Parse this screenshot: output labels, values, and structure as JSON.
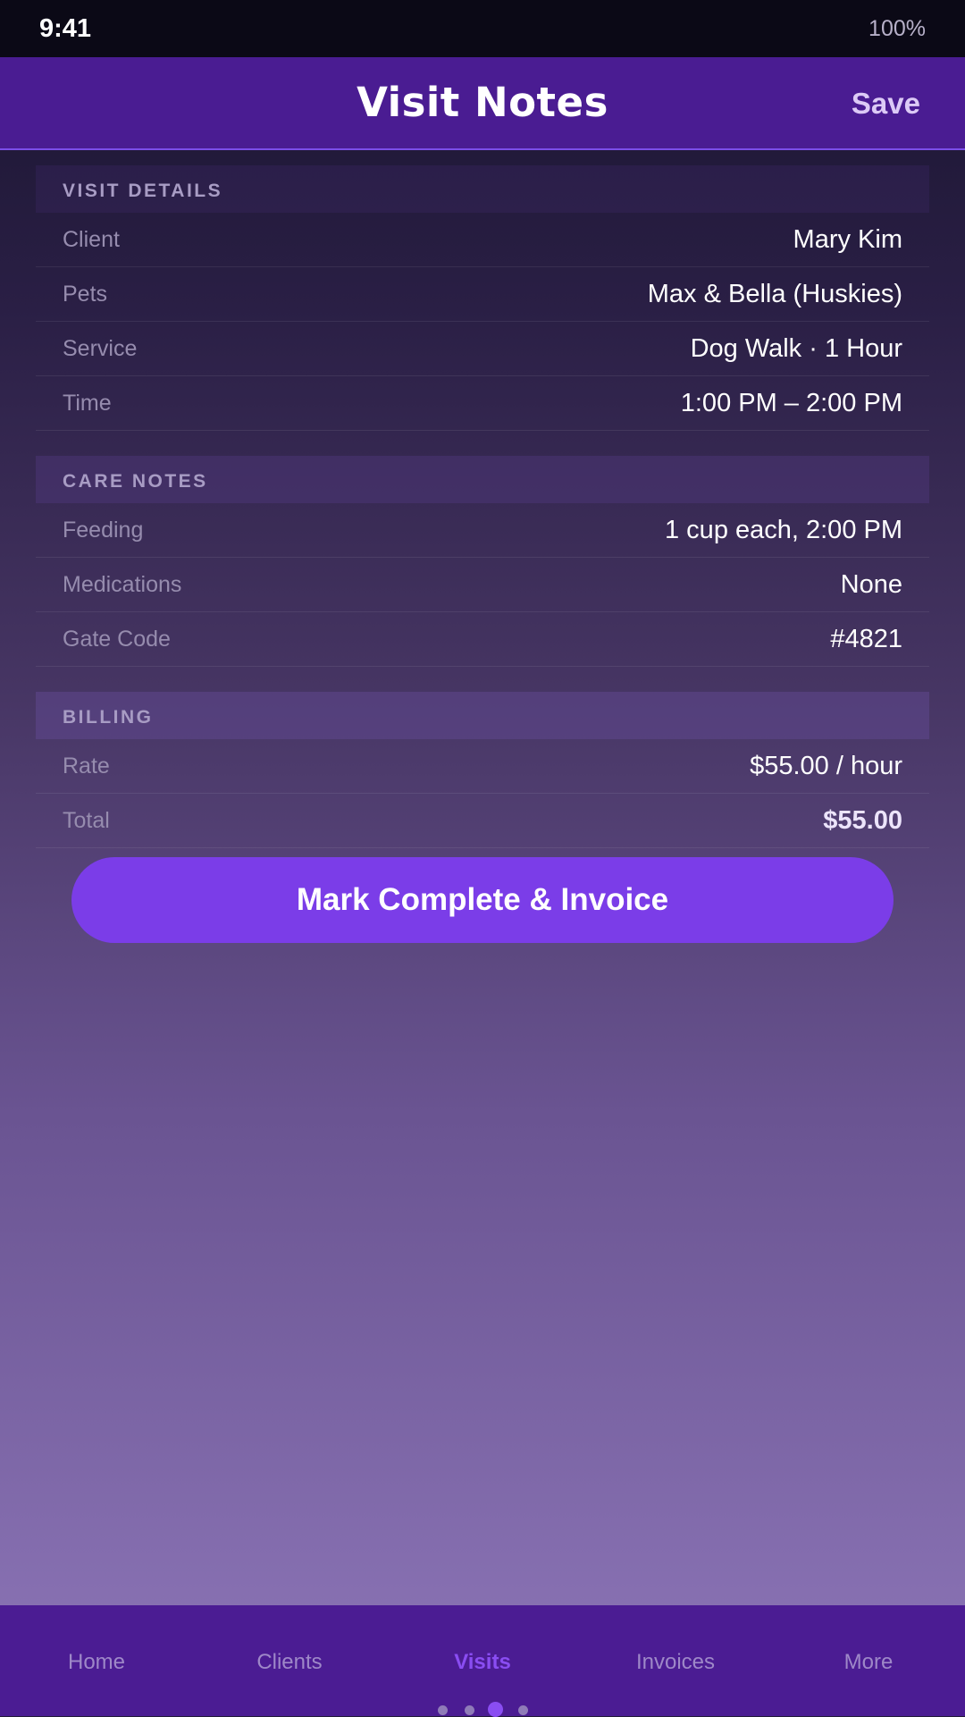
{
  "status_bar": {
    "time": "9:41",
    "battery": "100%"
  },
  "header": {
    "title": "Visit Notes",
    "save_label": "Save"
  },
  "sections": [
    {
      "title": "VISIT DETAILS",
      "rows": [
        {
          "label": "Client",
          "value": "Mary Kim"
        },
        {
          "label": "Pets",
          "value": "Max & Bella (Huskies)"
        },
        {
          "label": "Service",
          "value": "Dog Walk · 1 Hour"
        },
        {
          "label": "Time",
          "value": "1:00 PM – 2:00 PM"
        }
      ]
    },
    {
      "title": "CARE NOTES",
      "rows": [
        {
          "label": "Feeding",
          "value": "1 cup each, 2:00 PM"
        },
        {
          "label": "Medications",
          "value": "None"
        },
        {
          "label": "Gate Code",
          "value": "#4821"
        }
      ]
    },
    {
      "title": "BILLING",
      "rows": [
        {
          "label": "Rate",
          "value": "$55.00 / hour"
        },
        {
          "label": "Total",
          "value": "$55.00"
        }
      ]
    }
  ],
  "primary_action": {
    "label": "Mark Complete & Invoice"
  },
  "tab_bar": {
    "tabs": [
      {
        "label": "Home"
      },
      {
        "label": "Clients"
      },
      {
        "label": "Visits"
      },
      {
        "label": "Invoices"
      },
      {
        "label": "More"
      }
    ],
    "active_tab": "Visits"
  },
  "page_indicator": {
    "count": 4,
    "active_index": 2
  },
  "colors": {
    "header_bg": "#4a1c92",
    "accent": "#7b3de8",
    "active_tab": "#8a4df2",
    "status_bar_bg": "#0b0916"
  }
}
